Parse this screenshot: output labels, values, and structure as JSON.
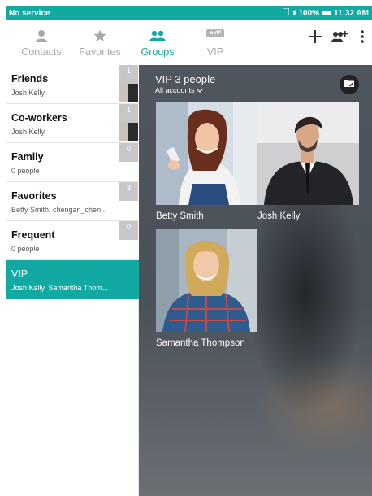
{
  "status": {
    "carrier": "No service",
    "battery": "100%",
    "time": "11:32 AM"
  },
  "tabs": [
    {
      "label": "Contacts",
      "icon": "person-icon"
    },
    {
      "label": "Favorites",
      "icon": "star-icon"
    },
    {
      "label": "Groups",
      "icon": "groups-icon"
    },
    {
      "label": "VIP",
      "icon": "vip-icon",
      "icon_text": "★VIP"
    }
  ],
  "actions": [
    "add-icon",
    "add-group-icon",
    "more-options-icon"
  ],
  "groups": [
    {
      "name": "Friends",
      "members": "Josh Kelly",
      "count": "1"
    },
    {
      "name": "Co-workers",
      "members": "Josh Kelly",
      "count": "1"
    },
    {
      "name": "Family",
      "members": "0 people",
      "count": "0"
    },
    {
      "name": "Favorites",
      "members": "Betty Smith, chengan_chen...",
      "count": "3"
    },
    {
      "name": "Frequent",
      "members": "0 people",
      "count": "0"
    },
    {
      "name": "VIP",
      "members": "Josh Kelly, Samantha Thom..."
    }
  ],
  "detail": {
    "title": "VIP 3 people",
    "accounts": "All accounts",
    "contacts": [
      {
        "name": "Betty Smith"
      },
      {
        "name": "Josh Kelly"
      },
      {
        "name": "Samantha Thompson"
      }
    ]
  },
  "colors": {
    "accent": "#13a9a3",
    "status_bar": "#13a9a3",
    "inactive_tab": "#a9a9a9",
    "badge": "#c7c7c7"
  }
}
